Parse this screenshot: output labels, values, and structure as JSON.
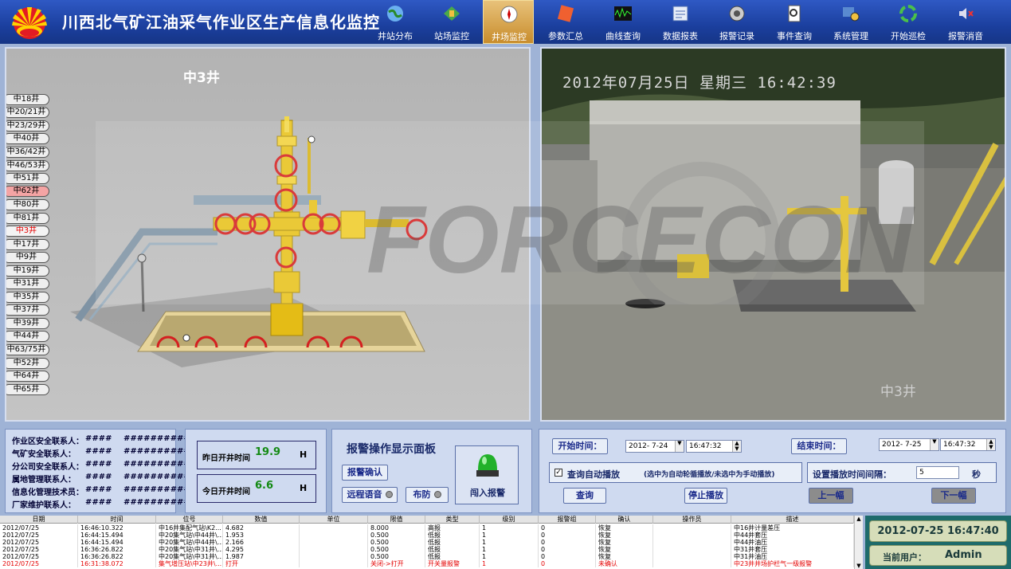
{
  "header": {
    "title": "川西北气矿江油采气作业区生产信息化监控",
    "nav": [
      {
        "label": "井站分布",
        "icon": "globe-icon"
      },
      {
        "label": "站场监控",
        "icon": "station-icon"
      },
      {
        "label": "井场监控",
        "icon": "well-monitor-icon"
      },
      {
        "label": "参数汇总",
        "icon": "params-icon"
      },
      {
        "label": "曲线查询",
        "icon": "curve-icon"
      },
      {
        "label": "数据报表",
        "icon": "report-icon"
      },
      {
        "label": "报警记录",
        "icon": "alarm-record-icon"
      },
      {
        "label": "事件查询",
        "icon": "event-icon"
      },
      {
        "label": "系统管理",
        "icon": "system-icon"
      },
      {
        "label": "开始巡检",
        "icon": "patrol-icon"
      },
      {
        "label": "报警消音",
        "icon": "mute-icon"
      }
    ],
    "active_nav": "井场监控"
  },
  "scene": {
    "well_title": "中3井",
    "wells": [
      "中18井",
      "中20/21井",
      "中23/29井",
      "中40井",
      "中36/42井",
      "中46/53井",
      "中51井",
      "中62井",
      "中80井",
      "中81井",
      "中3井",
      "中17井",
      "中9井",
      "中19井",
      "中31井",
      "中35井",
      "中37井",
      "中39井",
      "中44井",
      "中63/75井",
      "中52井",
      "中64井",
      "中65井"
    ],
    "alarm_well": "中62井",
    "current_well": "中3井"
  },
  "video": {
    "timestamp": "2012年07月25日 星期三 16:42:39",
    "caption": "中3井"
  },
  "contacts": [
    {
      "label": "作业区安全联系人：",
      "name": "####",
      "phone": "###########"
    },
    {
      "label": "气矿安全联系人：",
      "name": "####",
      "phone": "###########"
    },
    {
      "label": "分公司安全联系人：",
      "name": "####",
      "phone": "###########"
    },
    {
      "label": "属地管理联系人：",
      "name": "####",
      "phone": "###########"
    },
    {
      "label": "信息化管理技术员：",
      "name": "####",
      "phone": "###########"
    },
    {
      "label": "厂家维护联系人：",
      "name": "####",
      "phone": "###########"
    }
  ],
  "open_time": {
    "yesterday_label": "昨日开井时间",
    "yesterday_value": "19.9",
    "today_label": "今日开井时间",
    "today_value": "6.6",
    "unit": "H"
  },
  "alarm_panel": {
    "title": "报警操作显示面板",
    "confirm": "报警确认",
    "remote_voice": "远程语音",
    "arm": "布防",
    "intrusion": "闯入报警"
  },
  "playback": {
    "start_label": "开始时间：",
    "start_date": "2012- 7-24",
    "start_time": "16:47:32",
    "end_label": "结束时间：",
    "end_date": "2012- 7-25",
    "end_time": "16:47:32",
    "auto_label": "查询自动播放",
    "auto_hint": "(选中为自动轮循播放/未选中为手动播放)",
    "interval_label": "设置播放时间间隔：",
    "interval_value": "5",
    "interval_unit": "秒",
    "query": "查询",
    "stop": "停止播放",
    "prev": "上一幅",
    "next": "下一幅"
  },
  "log": {
    "columns": [
      "日期",
      "时间",
      "位号",
      "数值",
      "单位",
      "限值",
      "类型",
      "级别",
      "报警组",
      "确认",
      "操作员",
      "描述"
    ],
    "rows": [
      [
        "2012/07/25",
        "16:46:10.322",
        "中16井集配气站\\K2...",
        "4.682",
        "",
        "8.000",
        "高报",
        "1",
        "0",
        "恢复",
        "",
        "中16井计量差压"
      ],
      [
        "2012/07/25",
        "16:44:15.494",
        "中20集气站\\中44井\\...",
        "1.953",
        "",
        "0.500",
        "低报",
        "1",
        "0",
        "恢复",
        "",
        "中44井套压"
      ],
      [
        "2012/07/25",
        "16:44:15.494",
        "中20集气站\\中44井\\...",
        "2.166",
        "",
        "0.500",
        "低报",
        "1",
        "0",
        "恢复",
        "",
        "中44井油压"
      ],
      [
        "2012/07/25",
        "16:36:26.822",
        "中20集气站\\中31井\\...",
        "4.295",
        "",
        "0.500",
        "低报",
        "1",
        "0",
        "恢复",
        "",
        "中31井套压"
      ],
      [
        "2012/07/25",
        "16:36:26.822",
        "中20集气站\\中31井\\...",
        "1.987",
        "",
        "0.500",
        "低报",
        "1",
        "0",
        "恢复",
        "",
        "中31井油压"
      ],
      [
        "2012/07/25",
        "16:31:38.072",
        "集气增压站\\中23井\\...",
        "打开",
        "",
        "关闭->打开",
        "开关量报警",
        "1",
        "0",
        "未确认",
        "",
        "中23井井场护栏气一级报警"
      ]
    ]
  },
  "status": {
    "datetime": "2012-07-25 16:47:40",
    "user_label": "当前用户：",
    "user": "Admin"
  },
  "colors": {
    "header": "#1b3f9e",
    "valve_red": "#d42020",
    "wellhead_yellow": "#e8c21c",
    "alarm_red": "#e40000",
    "value_green": "#148a14"
  }
}
